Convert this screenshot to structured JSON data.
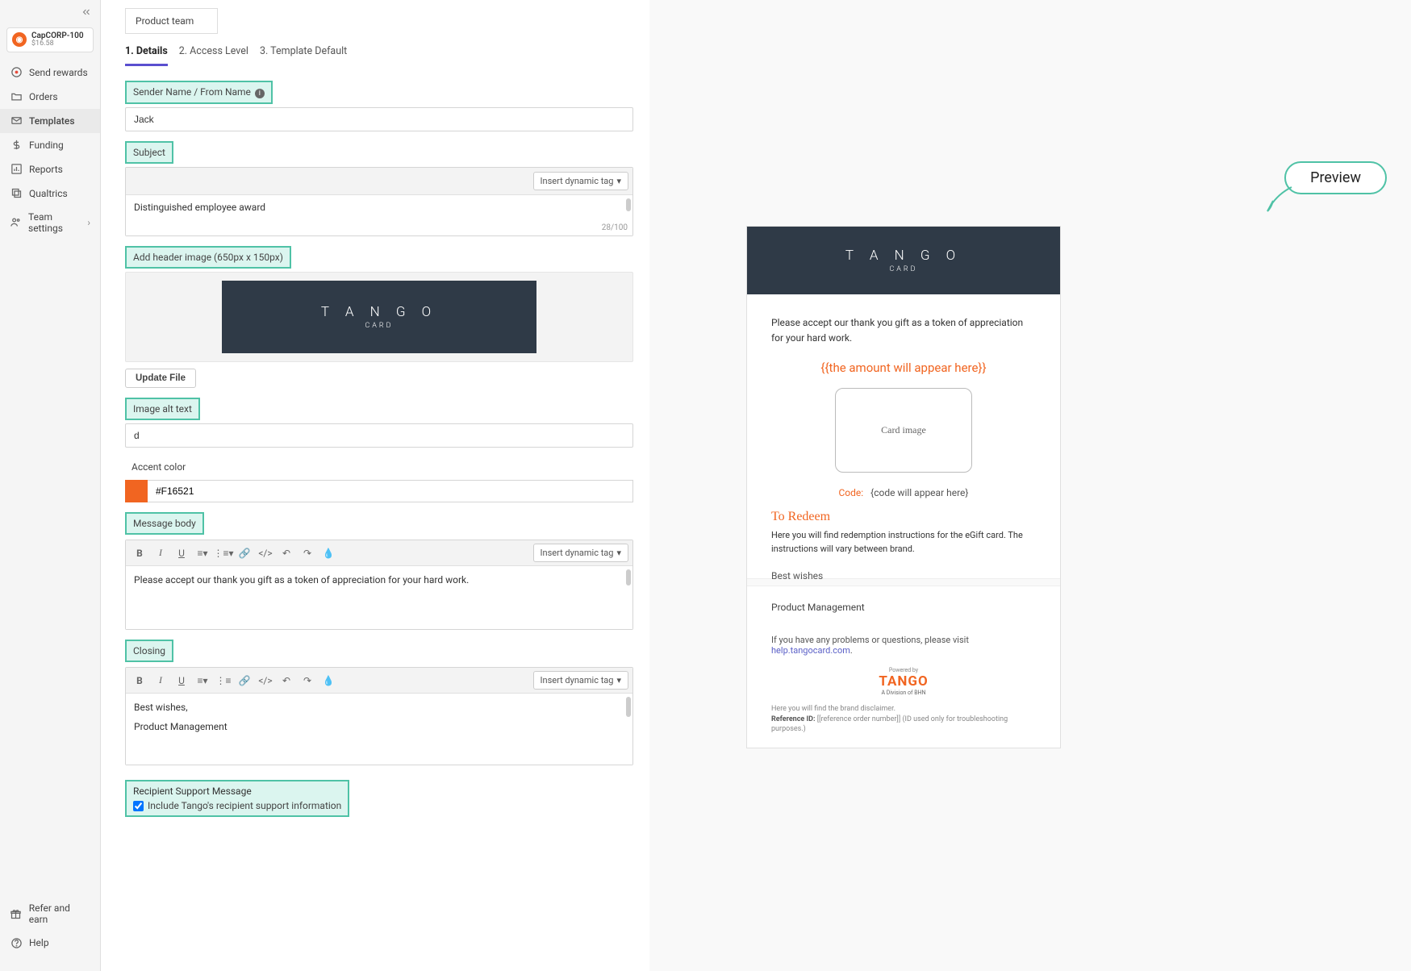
{
  "sidebar": {
    "org_name": "CapCORP-100",
    "org_balance": "$16.58",
    "items": [
      {
        "label": "Send rewards"
      },
      {
        "label": "Orders"
      },
      {
        "label": "Templates"
      },
      {
        "label": "Funding"
      },
      {
        "label": "Reports"
      },
      {
        "label": "Qualtrics"
      },
      {
        "label": "Team settings"
      }
    ],
    "bottom": [
      {
        "label": "Refer and earn"
      },
      {
        "label": "Help"
      }
    ]
  },
  "form": {
    "template_name": "Product team",
    "tabs": [
      "1. Details",
      "2. Access Level",
      "3. Template Default"
    ],
    "labels": {
      "sender": "Sender Name / From Name",
      "subject": "Subject",
      "insert_tag": "Insert dynamic tag",
      "header_image": "Add header image (650px x 150px)",
      "update_file": "Update File",
      "alt_text": "Image alt text",
      "accent_color": "Accent color",
      "message_body": "Message body",
      "closing": "Closing",
      "recipient_support": "Recipient Support Message",
      "include_support": "Include Tango's recipient support information"
    },
    "values": {
      "sender": "Jack",
      "subject": "Distinguished employee award",
      "subject_count": "28/100",
      "alt_text": "d",
      "accent_color": "#F16521",
      "message_body": "Please accept our thank you gift as a token of appreciation for your hard work.",
      "closing_line1": "Best wishes,",
      "closing_line2": "Product Management",
      "include_support_checked": true
    },
    "header_logo": {
      "line1": "T A N G O",
      "line2": "CARD"
    }
  },
  "preview": {
    "callout": "Preview",
    "header": {
      "line1": "T A N G O",
      "line2": "CARD"
    },
    "message": "Please accept our thank you gift as a token of appreciation for your hard work.",
    "amount_placeholder": "{{the amount will appear here}}",
    "card_image": "Card image",
    "code_label": "Code:",
    "code_value": "{code will appear here}",
    "redeem_title": "To Redeem",
    "redeem_text": "Here you will find redemption instructions for the eGift card. The instructions will vary between brand.",
    "closing_truncated": "Best wishes",
    "closing_full": "Product Management",
    "help_text": "If you have any problems or questions, please visit ",
    "help_link": "help.tangocard.com",
    "logo_sup": "Powered by",
    "logo_main": "TANGO",
    "logo_sub": "A Division of BHN",
    "disclaimer_line1": "Here you will find the brand disclaimer.",
    "disclaimer_ref_label": "Reference ID:",
    "disclaimer_ref_val": "[[reference order number]]",
    "disclaimer_ref_note": "(ID used only for troubleshooting purposes.)"
  }
}
